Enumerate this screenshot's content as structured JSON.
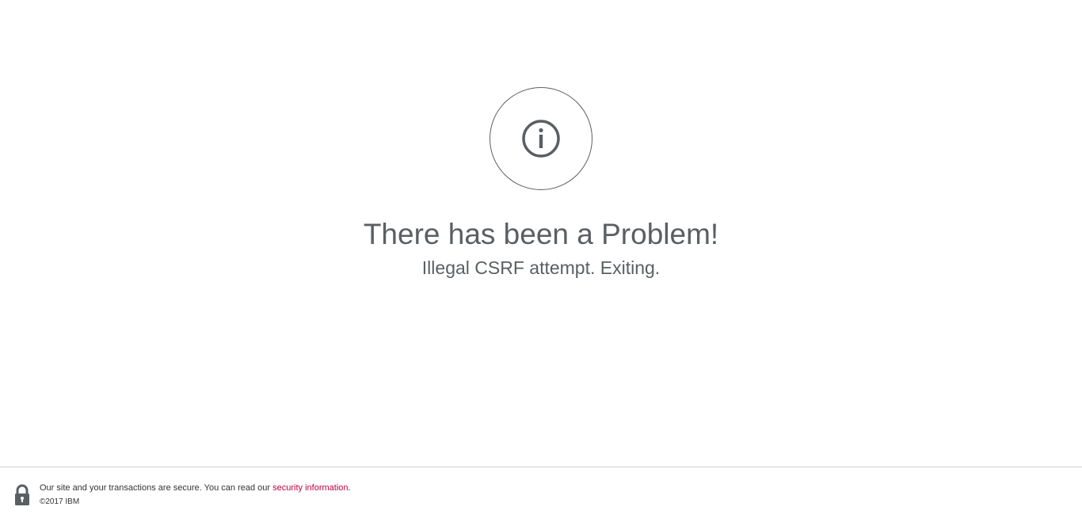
{
  "message": {
    "title": "There has been a Problem!",
    "detail": "Illegal CSRF attempt. Exiting."
  },
  "icons": {
    "status": "info-icon",
    "footer": "lock-icon"
  },
  "footer": {
    "secure_text": "Our site and your transactions are secure. You can read our ",
    "link_text": "security information",
    "trailing": ".",
    "copyright": "©2017 IBM"
  },
  "colors": {
    "text": "#5a5f63",
    "link": "#c0003c",
    "divider": "#d0d3d5"
  }
}
